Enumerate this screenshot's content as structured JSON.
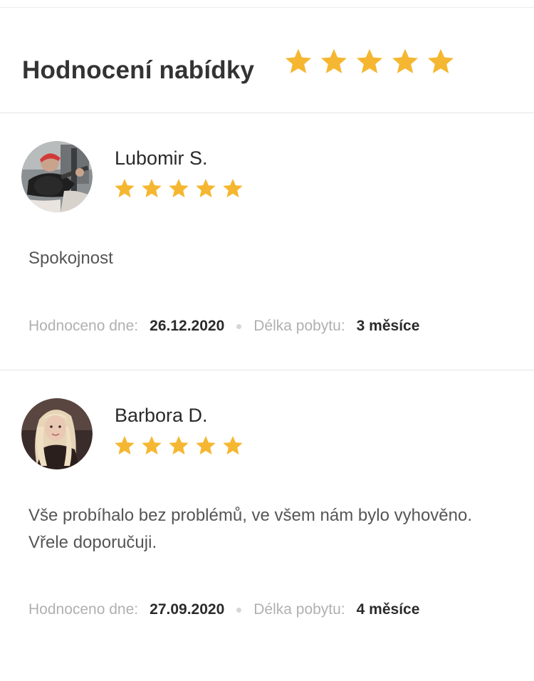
{
  "header": {
    "title": "Hodnocení nabídky",
    "rating": 5,
    "max_rating": 5
  },
  "colors": {
    "star": "#F5B731",
    "divider": "#E4E4E4",
    "meta_label": "#B0B0B0"
  },
  "reviews": [
    {
      "name": "Lubomir S.",
      "rating": 5,
      "text": "Spokojnost",
      "rated_label": "Hodnoceno dne:",
      "rated_date": "26.12.2020",
      "stay_label": "Délka pobytu:",
      "stay_length": "3 měsíce",
      "avatar_icon": "user-photo-guitar"
    },
    {
      "name": "Barbora D.",
      "rating": 5,
      "text": "Vše probíhalo bez problémů, ve všem nám bylo vyhověno. Vřele doporučuji.",
      "rated_label": "Hodnoceno dne:",
      "rated_date": "27.09.2020",
      "stay_label": "Délka pobytu:",
      "stay_length": "4 měsíce",
      "avatar_icon": "user-photo-blonde"
    }
  ]
}
